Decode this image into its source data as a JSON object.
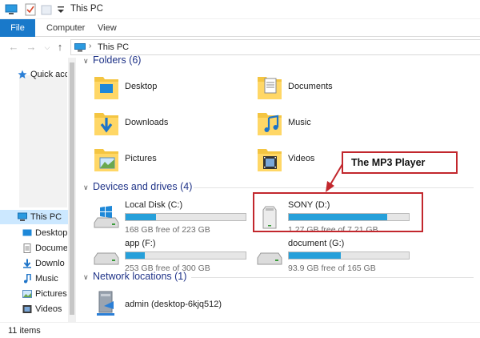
{
  "window": {
    "title": "This PC"
  },
  "ribbon": {
    "tabs": [
      "File",
      "Computer",
      "View"
    ]
  },
  "address": {
    "path": "This PC"
  },
  "sidebar": {
    "items": [
      {
        "label": "Quick acc",
        "icon": "star-icon"
      },
      {
        "label": "This PC",
        "icon": "pc-icon"
      },
      {
        "label": "Desktop",
        "icon": "desktop-folder-icon"
      },
      {
        "label": "Docume",
        "icon": "documents-folder-icon"
      },
      {
        "label": "Downlo",
        "icon": "downloads-folder-icon"
      },
      {
        "label": "Music",
        "icon": "music-folder-icon"
      },
      {
        "label": "Pictures",
        "icon": "pictures-folder-icon"
      },
      {
        "label": "Videos",
        "icon": "videos-folder-icon"
      }
    ]
  },
  "groups": {
    "folders": {
      "label": "Folders (6)"
    },
    "drives": {
      "label": "Devices and drives (4)"
    },
    "network": {
      "label": "Network locations (1)"
    }
  },
  "folders": [
    {
      "label": "Desktop",
      "icon": "desktop-folder-icon"
    },
    {
      "label": "Documents",
      "icon": "documents-folder-icon"
    },
    {
      "label": "Downloads",
      "icon": "downloads-folder-icon"
    },
    {
      "label": "Music",
      "icon": "music-folder-icon"
    },
    {
      "label": "Pictures",
      "icon": "pictures-folder-icon"
    },
    {
      "label": "Videos",
      "icon": "videos-folder-icon"
    }
  ],
  "drives": [
    {
      "name": "Local Disk (C:)",
      "free": "168 GB free of 223 GB",
      "used_fraction": 0.25,
      "icon": "windows-drive-icon"
    },
    {
      "name": "SONY (D:)",
      "free": "1.27 GB free of 7.21 GB",
      "used_fraction": 0.82,
      "icon": "removable-drive-icon"
    },
    {
      "name": "app (F:)",
      "free": "253 GB free of 300 GB",
      "used_fraction": 0.16,
      "icon": "hard-drive-icon"
    },
    {
      "name": "document (G:)",
      "free": "93.9 GB free of 165 GB",
      "used_fraction": 0.43,
      "icon": "hard-drive-icon"
    }
  ],
  "network": [
    {
      "name": "admin (desktop-6kjq512)",
      "icon": "network-share-icon"
    }
  ],
  "annotation": {
    "text": "The MP3 Player"
  },
  "status": {
    "count": "11 items"
  },
  "colors": {
    "accent": "#1979ca",
    "progress": "#26a0da",
    "annotation": "#c2272d",
    "group_heading": "#1e3287"
  }
}
